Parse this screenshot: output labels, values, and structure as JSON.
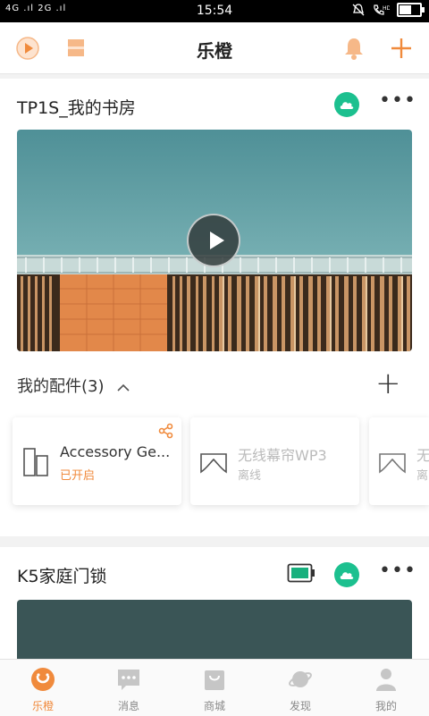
{
  "status_bar": {
    "signal_text": "4G .ıl 2G .ıl",
    "time": "15:54"
  },
  "header": {
    "title": "乐橙"
  },
  "device1": {
    "name": "TP1S_我的书房",
    "accessories_title": "我的配件(3)",
    "accessories": [
      {
        "name": "Accessory Ge...",
        "status": "已开启"
      },
      {
        "name": "无线幕帘WP3",
        "status": "离线"
      },
      {
        "name": "无",
        "status": "离"
      }
    ]
  },
  "device2": {
    "name": "K5家庭门锁"
  },
  "tabs": [
    {
      "label": "乐橙"
    },
    {
      "label": "消息"
    },
    {
      "label": "商城"
    },
    {
      "label": "发现"
    },
    {
      "label": "我的"
    }
  ],
  "colors": {
    "accent": "#f08a3c",
    "cloud_green": "#1cc08f",
    "battery_green": "#18b07e"
  }
}
